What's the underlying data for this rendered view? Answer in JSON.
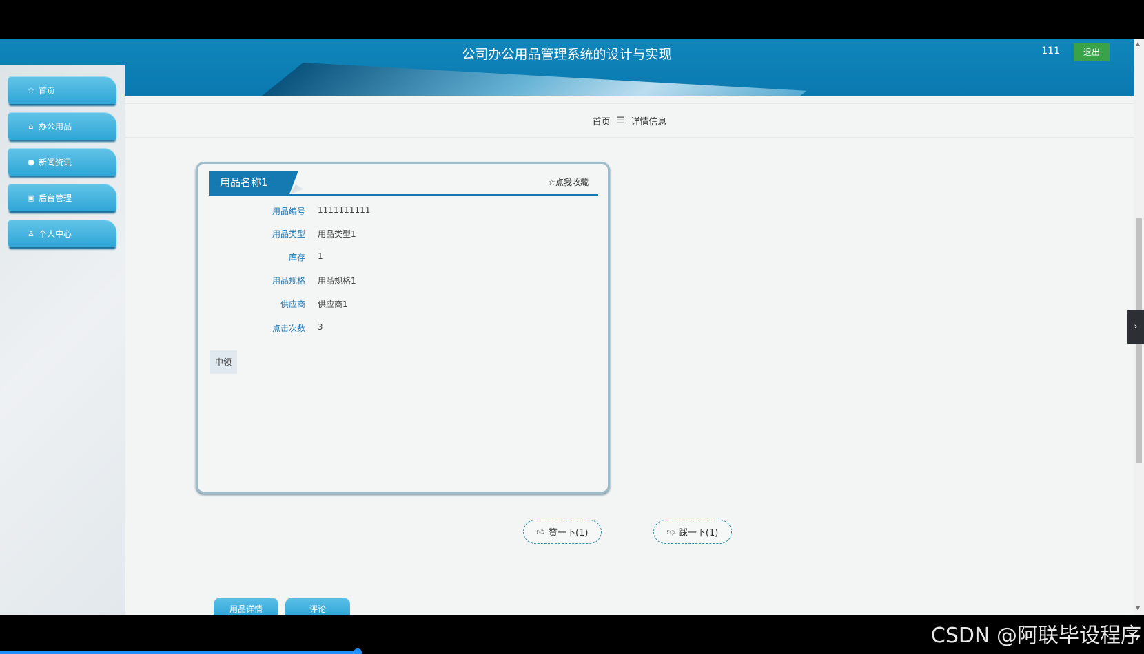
{
  "header": {
    "title": "公司办公用品管理系统的设计与实现",
    "user": "111",
    "logout_label": "退出"
  },
  "sidebar": {
    "items": [
      {
        "label": "首页",
        "icon": "☆"
      },
      {
        "label": "办公用品",
        "icon": "⌂"
      },
      {
        "label": "新闻资讯",
        "icon": "●"
      },
      {
        "label": "后台管理",
        "icon": "▣"
      },
      {
        "label": "个人中心",
        "icon": "♙"
      }
    ]
  },
  "breadcrumb": {
    "home": "首页",
    "separator": "☰",
    "current": "详情信息"
  },
  "detail": {
    "title": "用品名称1",
    "favorite_label": "☆点我收藏",
    "fields": [
      {
        "label": "用品编号",
        "value": "1111111111"
      },
      {
        "label": "用品类型",
        "value": "用品类型1"
      },
      {
        "label": "库存",
        "value": "1"
      },
      {
        "label": "用品规格",
        "value": "用品规格1"
      },
      {
        "label": "供应商",
        "value": "供应商1"
      },
      {
        "label": "点击次数",
        "value": "3"
      }
    ],
    "apply_label": "申领"
  },
  "votes": {
    "like_label": "赞一下(1)",
    "dislike_label": "踩一下(1)"
  },
  "tabs": [
    "用品详情",
    "评论"
  ],
  "watermark": "CSDN @阿联毕设程序"
}
